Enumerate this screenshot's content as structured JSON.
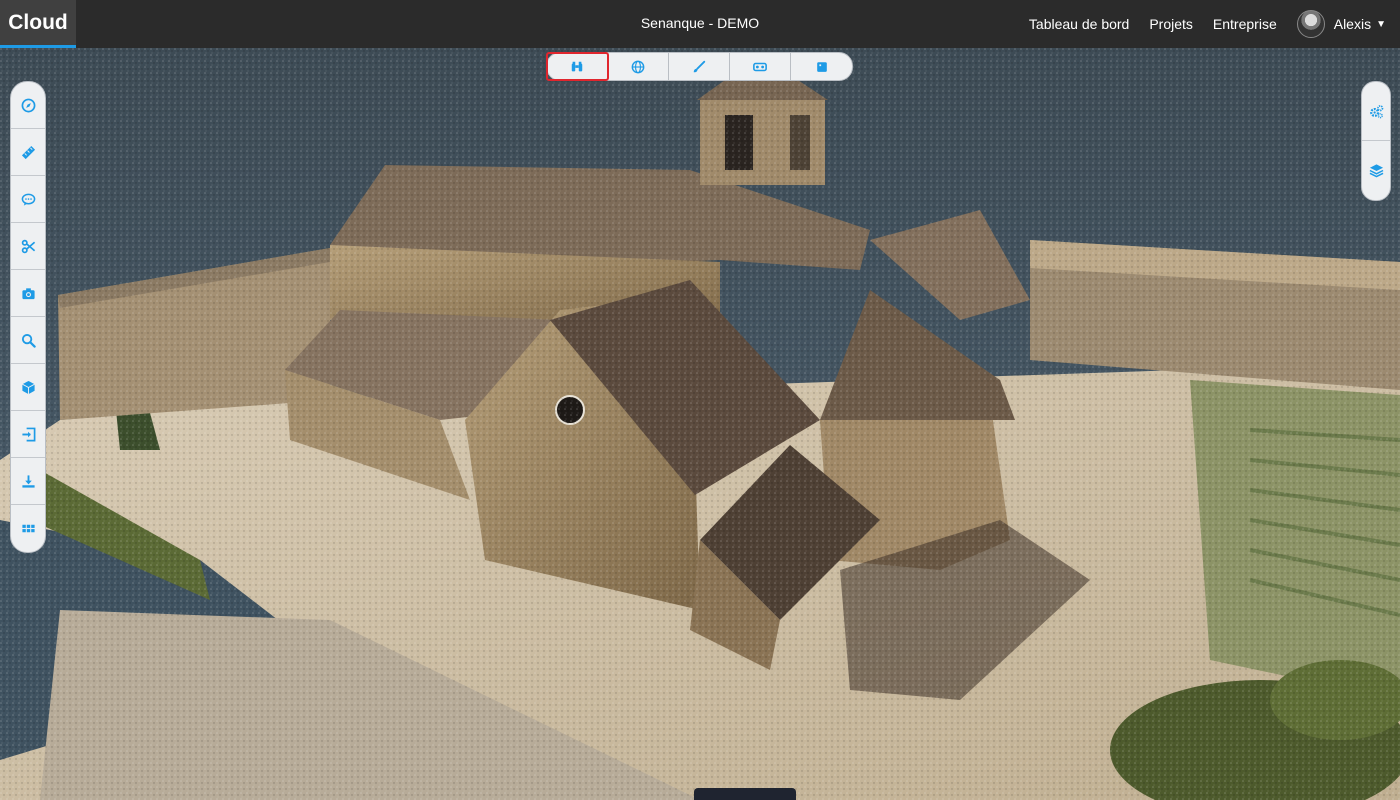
{
  "app": {
    "brand": "Cloud",
    "project_title": "Senanque - DEMO"
  },
  "nav": {
    "links": [
      "Tableau de bord",
      "Projets",
      "Entreprise"
    ],
    "user_name": "Alexis"
  },
  "colors": {
    "accent": "#1e9be6",
    "topbar": "#2b2b2b",
    "active_outline": "#e0262e"
  },
  "view_toolbar": {
    "buttons": [
      "binoculars-icon",
      "globe-icon",
      "brush-icon",
      "vr-headset-icon",
      "square-icon"
    ],
    "active": "binoculars-icon"
  },
  "left_toolbar": {
    "buttons": [
      "compass-icon",
      "ruler-icon",
      "comment-icon",
      "scissors-icon",
      "camera-icon",
      "search-icon",
      "cube-icon",
      "import-icon",
      "download-icon",
      "grid-icon"
    ]
  },
  "right_toolbar": {
    "buttons": [
      "cogs-icon",
      "layers-icon"
    ]
  }
}
